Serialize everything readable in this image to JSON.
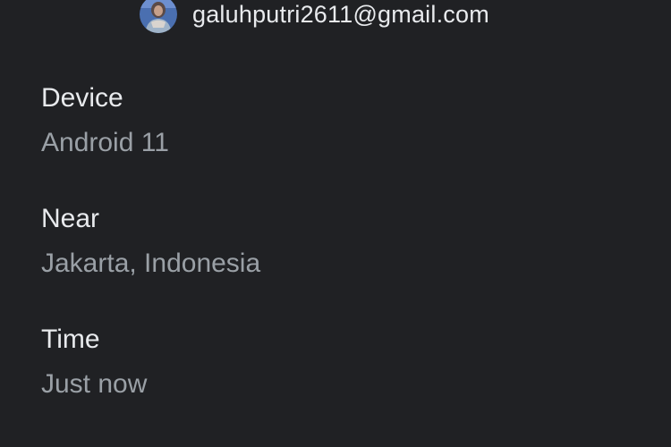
{
  "account": {
    "email": "galuhputri2611@gmail.com",
    "avatar_icon": "user-photo-avatar"
  },
  "details": {
    "device": {
      "label": "Device",
      "value": "Android 11"
    },
    "near": {
      "label": "Near",
      "value": "Jakarta, Indonesia"
    },
    "time": {
      "label": "Time",
      "value": "Just now"
    }
  },
  "colors": {
    "background": "#202124",
    "primary_text": "#e8eaed",
    "secondary_text": "#9aa0a6"
  }
}
